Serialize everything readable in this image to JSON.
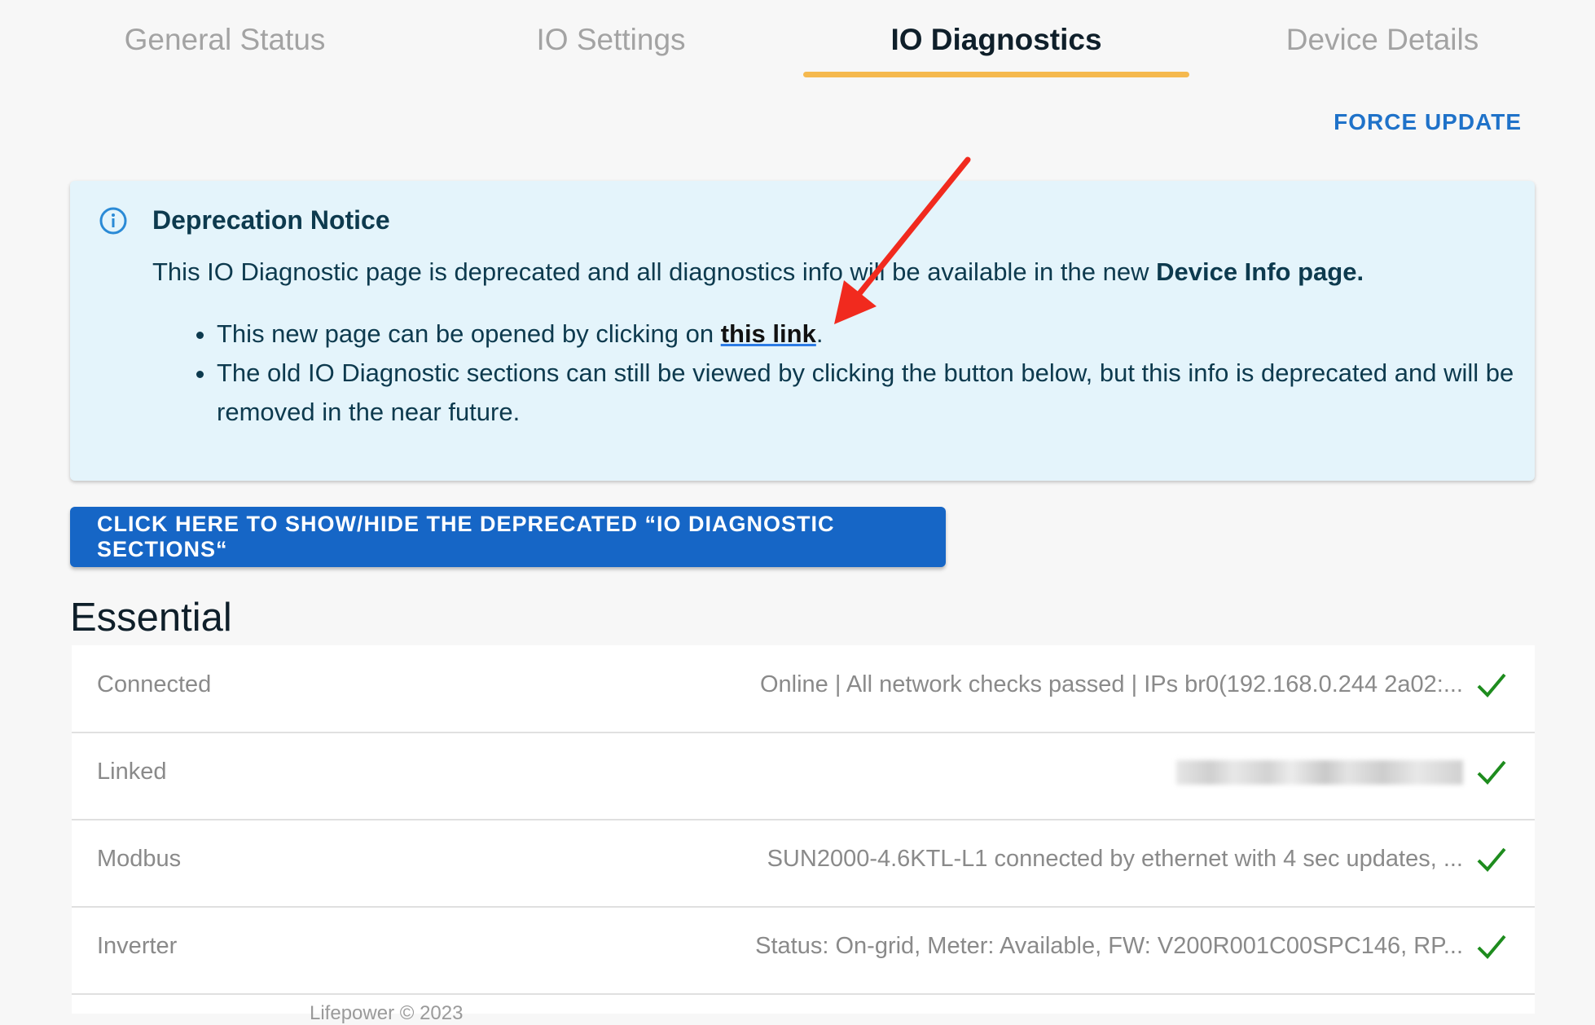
{
  "tabs": [
    {
      "label": "General Status",
      "active": false
    },
    {
      "label": "IO Settings",
      "active": false
    },
    {
      "label": "IO Diagnostics",
      "active": true
    },
    {
      "label": "Device Details",
      "active": false
    }
  ],
  "force_update_label": "FORCE UPDATE",
  "notice": {
    "title": "Deprecation Notice",
    "body_prefix": "This IO Diagnostic page is deprecated and all diagnostics info will be available in the new ",
    "body_bold": "Device Info page.",
    "bullet1_prefix": "This new page can be opened by clicking on ",
    "bullet1_link": "this link",
    "bullet1_suffix": ".",
    "bullet2": "The old IO Diagnostic sections can still be viewed by clicking the button below, but this info is deprecated and will be removed in the near future."
  },
  "toggle_button_label": "CLICK HERE TO SHOW/HIDE THE DEPRECATED “IO DIAGNOSTIC SECTIONS“",
  "section_title": "Essential",
  "rows": [
    {
      "label": "Connected",
      "value": "Online | All network checks passed | IPs br0(192.168.0.244 2a02:...",
      "icon": "check-icon"
    },
    {
      "label": "Linked",
      "value": "",
      "icon": "check-icon"
    },
    {
      "label": "Modbus",
      "value": "SUN2000-4.6KTL-L1 connected by ethernet with 4 sec updates, ...",
      "icon": "check-icon"
    },
    {
      "label": "Inverter",
      "value": "Status: On-grid, Meter: Available, FW: V200R001C00SPC146, RP...",
      "icon": "check-icon"
    }
  ],
  "footer_partial": "Lifepower © 2023",
  "colors": {
    "accent_tab_underline": "#f5b94f",
    "primary_button": "#1666c6",
    "link_blue": "#1f72c9",
    "notice_bg": "#e4f4fb",
    "check_green": "#1e8c1e",
    "annotation_arrow": "#f12a1e"
  }
}
